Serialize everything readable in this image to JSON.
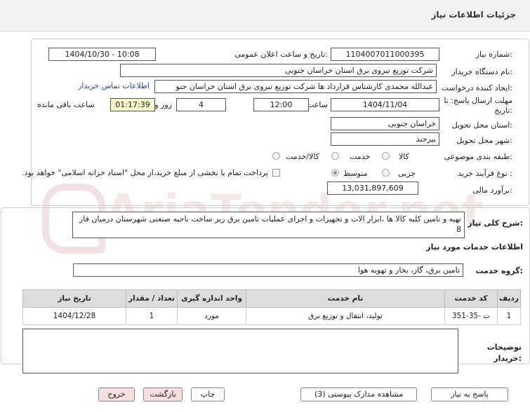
{
  "header": {
    "title": "جزئیات اطلاعات نیاز"
  },
  "watermark": "AriaTender.net",
  "form": {
    "need_number_label": "شماره نیاز:",
    "need_number": "1104007011000395",
    "announce_label": "تاریخ و ساعت اعلان عمومی:",
    "announce_value": "1404/10/30 - 10:08",
    "buyer_label": "نام دستگاه خریدار:",
    "buyer_value": "شرکت توزیع نیروی برق استان خراسان جنوبی",
    "creator_label": "ایجاد کننده درخواست:",
    "creator_value": "عبدالله محمدی کارشناس قرارداد ها شرکت توزیع نیروی برق استان خراسان جنو",
    "contact_link": "اطلاعات تماس خریدار",
    "deadline_label_1": "مهلت ارسال پاسخ: تا",
    "deadline_label_2": "تاریخ:",
    "deadline_date": "1404/11/04",
    "time_label": "ساعت",
    "deadline_time": "12:00",
    "days_value": "4",
    "days_label": "روز و",
    "remaining_time": "01:17:39",
    "remaining_label": "ساعت باقی مانده",
    "province_label": "استان محل تحویل:",
    "province_value": "خراسان جنوبی",
    "city_label": "شهر محل تحویل:",
    "city_value": "بیرجند",
    "category_label": "طبقه بندی موضوعی:",
    "category_options": [
      "کالا",
      "خدمت",
      "کالا/خدمت"
    ],
    "process_label": "نوع فرآیند خرید :",
    "process_options": [
      "جزیی",
      "متوسط"
    ],
    "process_selected": "متوسط",
    "payment_note": "پرداخت تمام یا بخشی از مبلغ خرید،از محل \"اسناد خزانه اسلامی\" خواهد بود.",
    "estimate_label": "برآورد مالی:",
    "estimate_value": "13,031,897,609"
  },
  "description": {
    "label": "شرح کلی نیاز:",
    "value": "تهیه و تامین کلیه کالا ها ،ابزار الات و تجهیزات و اجرای عملیات تامین برق زیر ساخت ناحیه صنعتی شهرستان درمیان فاز 8",
    "services_title": "اطلاعات خدمات مورد نیاز",
    "group_label": "گروه خدمت:",
    "group_value": "تامین برق، گاز، بخار و تهویه هوا"
  },
  "table": {
    "columns": [
      "ردیف",
      "کد خدمت",
      "نام خدمت",
      "واحد اندازه گیری",
      "تعداد / مقدار",
      "تاریخ نیاز"
    ],
    "rows": [
      [
        "1",
        "ت -35-351",
        "تولید، انتقال و توزیع برق",
        "مورد",
        "1",
        "1404/12/28"
      ]
    ]
  },
  "buyer_notes": {
    "label_1": "توضیحات",
    "label_2": "خریدار:",
    "value": ""
  },
  "buttons": {
    "reply": "پاسخ به نیاز",
    "attachments": "مشاهده مدارک پیوستی (3)",
    "print": "چاپ",
    "back": "بازگشت",
    "exit": "خروج"
  },
  "colors": {
    "link": "#1a4fb4",
    "highlight": "#fdf6c6",
    "button_pink": "#f9dede"
  }
}
